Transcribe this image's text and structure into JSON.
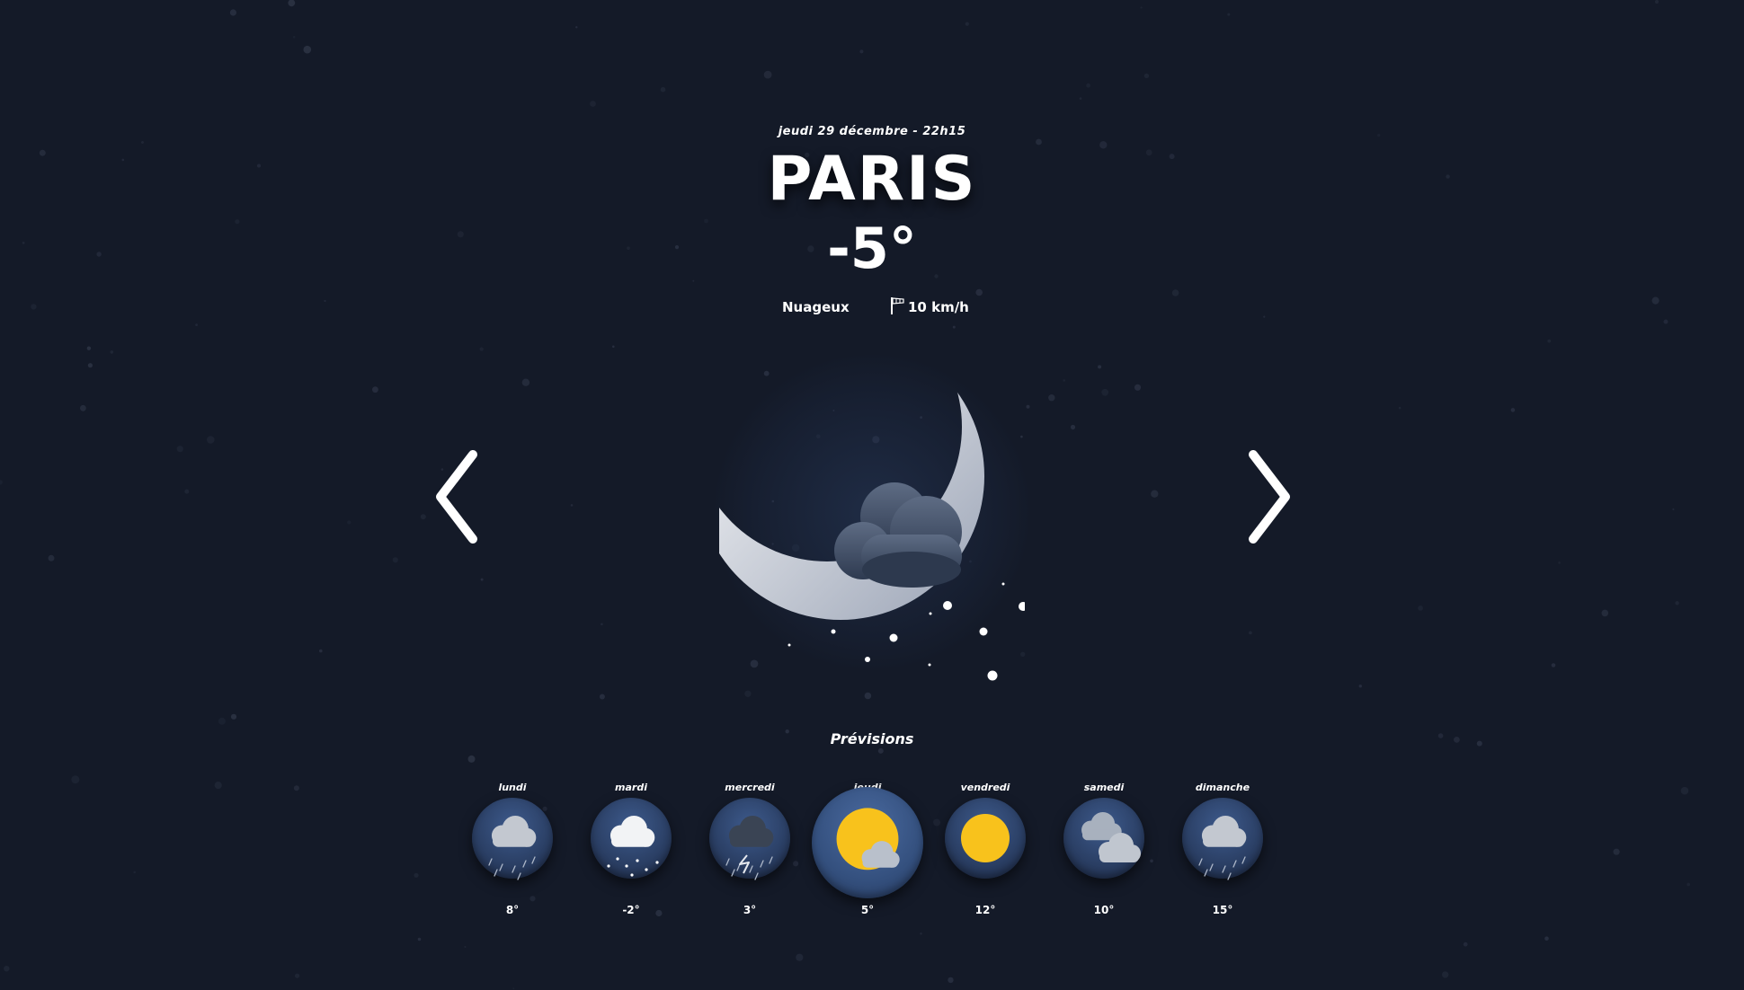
{
  "current": {
    "date": "jeudi 29 décembre - 22h15",
    "city": "PARIS",
    "temperature": "-5°",
    "condition": "Nuageux",
    "wind": "10 km/h",
    "icon": "moon-cloud-snow-icon"
  },
  "navigation": {
    "prev_icon": "chevron-left-icon",
    "next_icon": "chevron-right-icon"
  },
  "forecast": {
    "title": "Prévisions",
    "days": [
      {
        "label": "lundi",
        "temp": "8°",
        "icon": "cloud-rain-icon"
      },
      {
        "label": "mardi",
        "temp": "-2°",
        "icon": "cloud-snow-icon"
      },
      {
        "label": "mercredi",
        "temp": "3°",
        "icon": "cloud-storm-icon"
      },
      {
        "label": "jeudi",
        "temp": "5°",
        "icon": "sun-cloud-icon",
        "active": true
      },
      {
        "label": "vendredi",
        "temp": "12°",
        "icon": "sun-icon"
      },
      {
        "label": "samedi",
        "temp": "10°",
        "icon": "clouds-icon"
      },
      {
        "label": "dimanche",
        "temp": "15°",
        "icon": "cloud-rain-icon"
      }
    ]
  },
  "colors": {
    "background": "#141a28",
    "sun": "#f8c21c",
    "circle": "#2f4670"
  }
}
